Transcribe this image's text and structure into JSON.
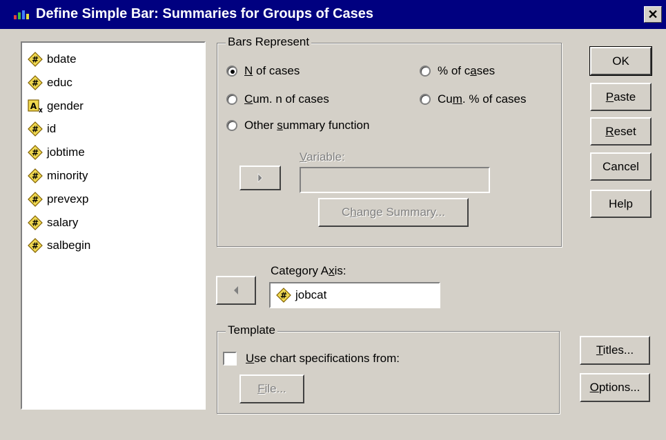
{
  "window": {
    "title": "Define Simple Bar: Summaries for Groups of Cases",
    "close_glyph": "✕"
  },
  "variables": [
    {
      "name": "bdate",
      "type": "numeric"
    },
    {
      "name": "educ",
      "type": "numeric"
    },
    {
      "name": "gender",
      "type": "string"
    },
    {
      "name": "id",
      "type": "numeric"
    },
    {
      "name": "jobtime",
      "type": "numeric"
    },
    {
      "name": "minority",
      "type": "numeric"
    },
    {
      "name": "prevexp",
      "type": "numeric"
    },
    {
      "name": "salary",
      "type": "numeric"
    },
    {
      "name": "salbegin",
      "type": "numeric"
    }
  ],
  "bars_represent": {
    "label": "Bars Represent",
    "options": {
      "n_of_cases": {
        "pre": "",
        "key": "N",
        "post": " of cases",
        "selected": true
      },
      "pct_of_cases": {
        "pre": "% of c",
        "key": "a",
        "post": "ses",
        "selected": false
      },
      "cum_n_of_cases": {
        "pre": "",
        "key": "C",
        "post": "um. n of cases",
        "selected": false
      },
      "cum_pct_of_cases": {
        "pre": "Cu",
        "key": "m",
        "post": ". % of cases",
        "selected": false
      },
      "other_summary": {
        "pre": "Other ",
        "key": "s",
        "post": "ummary function",
        "selected": false
      }
    },
    "variable_label": {
      "key": "V",
      "rest": "ariable:"
    },
    "variable_value": "",
    "change_summary": {
      "pre": "C",
      "key": "h",
      "post": "ange Summary..."
    }
  },
  "category_axis": {
    "label": {
      "pre": "Category A",
      "key": "x",
      "post": "is:"
    },
    "value": "jobcat",
    "value_type": "numeric"
  },
  "template": {
    "label": "Template",
    "use_spec": {
      "key": "U",
      "rest": "se chart specifications from:",
      "checked": false
    },
    "file_button": {
      "key": "F",
      "rest": "ile..."
    }
  },
  "buttons": {
    "ok": "OK",
    "paste": {
      "key": "P",
      "rest": "aste"
    },
    "reset": {
      "key": "R",
      "rest": "eset"
    },
    "cancel": "Cancel",
    "help": "Help",
    "titles": {
      "key": "T",
      "rest": "itles..."
    },
    "options": {
      "key": "O",
      "rest": "ptions..."
    }
  },
  "icons": {
    "numeric": "numeric-variable-icon",
    "string": "string-variable-icon",
    "arrow_right": "arrow-right-icon",
    "arrow_left": "arrow-left-icon"
  }
}
